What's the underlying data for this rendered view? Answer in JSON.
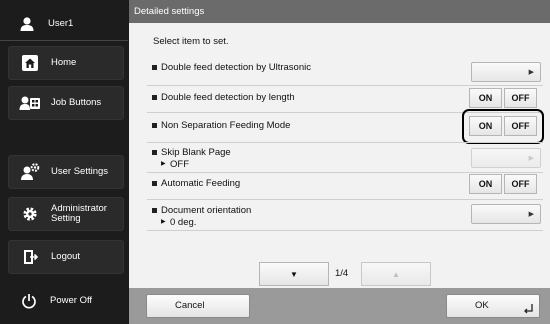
{
  "sidebar": {
    "user": {
      "label": "User1",
      "icon": "user-icon"
    },
    "items": [
      {
        "label": "Home",
        "icon": "home-icon"
      },
      {
        "label": "Job Buttons",
        "icon": "job-buttons-icon"
      },
      {
        "label": "User Settings",
        "icon": "user-settings-icon"
      },
      {
        "label": "Administrator\nSetting",
        "icon": "gear-icon"
      },
      {
        "label": "Logout",
        "icon": "logout-icon"
      },
      {
        "label": "Power Off",
        "icon": "power-icon"
      }
    ]
  },
  "main": {
    "title": "Detailed settings",
    "subtitle": "Select item to set.",
    "settings": [
      {
        "name": "Double feed detection by Ultrasonic",
        "control": "arrow"
      },
      {
        "name": "Double feed detection by length",
        "control": "toggle",
        "on_label": "ON",
        "off_label": "OFF"
      },
      {
        "name": "Non Separation Feeding Mode",
        "control": "toggle",
        "on_label": "ON",
        "off_label": "OFF",
        "highlighted": true
      },
      {
        "name": "Skip Blank Page",
        "value": "OFF",
        "control": "arrow",
        "disabled": true
      },
      {
        "name": "Automatic Feeding",
        "control": "toggle",
        "on_label": "ON",
        "off_label": "OFF"
      },
      {
        "name": "Document orientation",
        "value": "0 deg.",
        "control": "arrow"
      }
    ],
    "pager": {
      "current": "1/4",
      "down_icon": "triangle-down-icon",
      "up_icon": "triangle-up-icon"
    },
    "cancel_label": "Cancel",
    "ok_label": "OK"
  }
}
